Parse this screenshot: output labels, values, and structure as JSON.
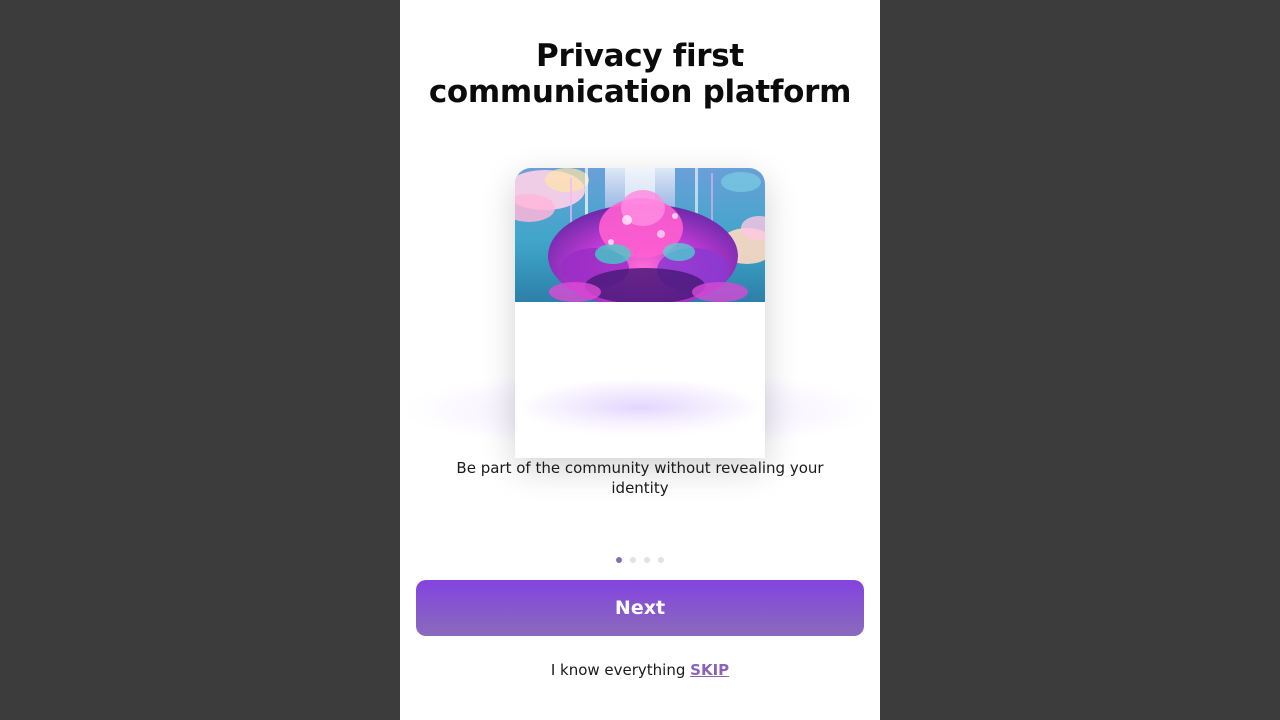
{
  "onboarding": {
    "title_line1": "Privacy first",
    "title_line2": "communication platform",
    "description": "Be part of the community without revealing your identity",
    "illustration": "fantasy-flower-tower-illustration",
    "pagination": {
      "current": 1,
      "total": 4
    },
    "next_label": "Next",
    "skip_prompt": "I know everything",
    "skip_label": "SKIP"
  },
  "colors": {
    "button_top": "#8343e0",
    "button_bottom": "#8a6bbb",
    "skip_link": "#8a63b8",
    "dot_active": "#8b6bb5",
    "dot_inactive": "#e2e2e2",
    "backdrop": "#3c3c3c"
  }
}
